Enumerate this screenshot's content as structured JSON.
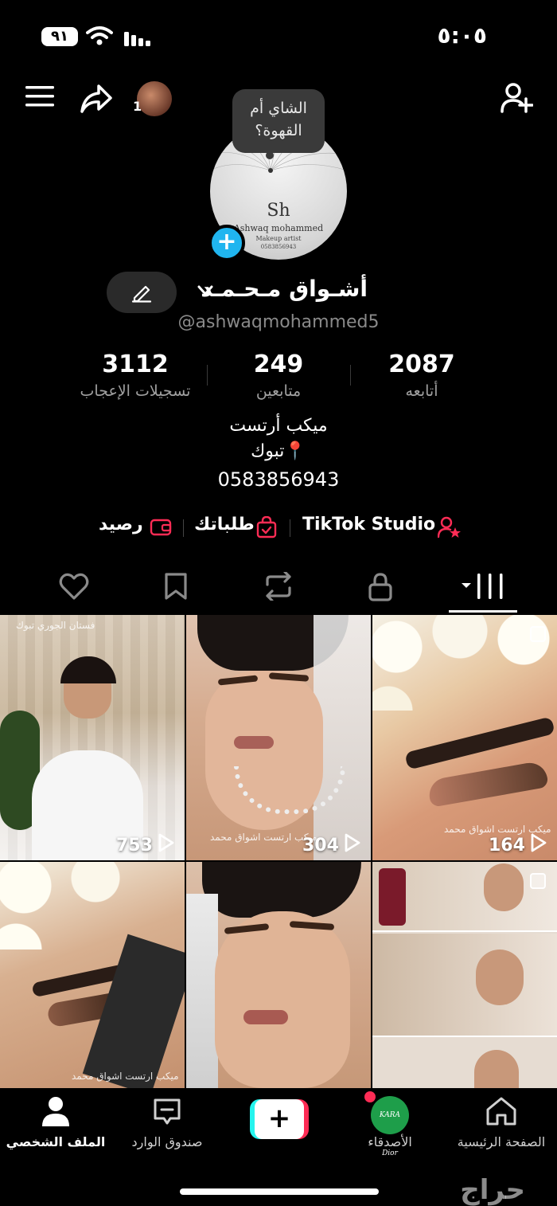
{
  "status_bar": {
    "battery": "٩١",
    "time": "٥:٠٥"
  },
  "top_nav": {
    "story_count": "1"
  },
  "profile": {
    "note": "الشاي أم القهوة؟",
    "avatar_logo": "Sh",
    "avatar_name": "Ashwaq mohammed",
    "avatar_role": "Makeup artist",
    "avatar_phone": "0583856943",
    "display_name": "أشـواق مـحـمـد",
    "username": "@ashwaqmohammed5"
  },
  "stats": {
    "likes": {
      "value": "3112",
      "label": "تسجيلات الإعجاب"
    },
    "followers": {
      "value": "249",
      "label": "متابعين"
    },
    "following": {
      "value": "2087",
      "label": "أتابعه"
    }
  },
  "bio": {
    "line1": "ميكب أرتست",
    "line2": "📍تبوك",
    "line3": "0583856943"
  },
  "links": {
    "studio": "TikTok Studio",
    "orders": "طلباتك",
    "balance": "رصيد"
  },
  "grid": {
    "views": [
      "753",
      "304",
      "164"
    ],
    "captions": [
      "فستان الجوري تبوك",
      "ميكب ارتست اشواق محمد",
      "ميكب ارتست اشواق محمد",
      "ميكب ارتست اشواق محمد"
    ]
  },
  "bottom_nav": {
    "profile": "الملف الشخصي",
    "inbox": "صندوق الوارد",
    "friends": "الأصدقاء",
    "friends_avatar_text": "KARA Dior",
    "home": "الصفحة الرئيسية"
  },
  "watermark": "حراج",
  "colors": {
    "accent_red": "#fe2c55",
    "accent_cyan": "#25f4ee",
    "badge_blue": "#20b5ef"
  }
}
